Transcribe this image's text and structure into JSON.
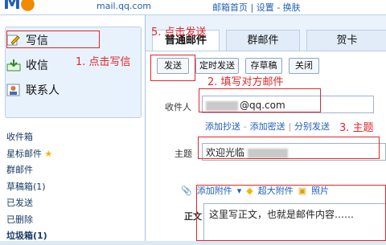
{
  "header": {
    "logo": "M",
    "logo_dot": "●",
    "url": "mail.qq.com",
    "links": "邮箱首页 | 设置 - 换肤"
  },
  "sidebar": {
    "write": "写信",
    "inbox": "收信",
    "contacts": "联系人",
    "folders": [
      {
        "label": "收件箱"
      },
      {
        "label": "星标邮件"
      },
      {
        "label": "群邮件"
      },
      {
        "label": "草稿箱(1)"
      },
      {
        "label": "已发送"
      },
      {
        "label": "已删除"
      },
      {
        "label": "垃圾箱(1)"
      }
    ]
  },
  "tabs": [
    "普通邮件",
    "群邮件",
    "贺卡"
  ],
  "toolbar": {
    "send": "发送",
    "timed_send": "定时发送",
    "save_draft": "存草稿",
    "close": "关闭"
  },
  "form": {
    "to_label": "收件人",
    "to_value": "@qq.com",
    "add_cc": "添加抄送",
    "add_bcc": "添加密送",
    "separate_send": "分别发送",
    "subject_label": "主题",
    "subject_value": "欢迎光临",
    "add_attachment": "添加附件",
    "super_attachment": "超大附件",
    "photo": "照片",
    "body_label": "正文",
    "body_value": "这里写正文，也就是邮件内容……"
  },
  "annotations": {
    "a1": "1. 点击写信",
    "a2": "2. 填写对方邮件",
    "a3": "3. 主题",
    "a5": "5. 点击发送"
  },
  "colors": {
    "annotation": "#e2262b",
    "link": "#1f5fb8",
    "star": "#f2b600"
  }
}
